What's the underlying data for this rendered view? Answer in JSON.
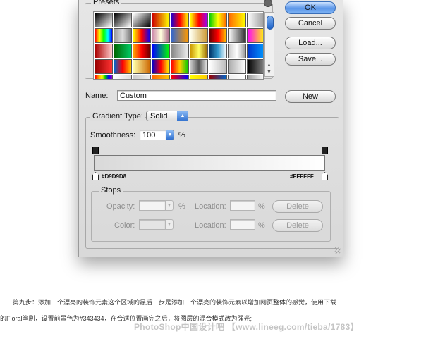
{
  "dialog": {
    "presets_label": "Presets",
    "buttons": {
      "ok": "OK",
      "cancel": "Cancel",
      "load": "Load...",
      "save": "Save...",
      "new": "New"
    },
    "name_label": "Name:",
    "name_value": "Custom",
    "gradient_type_label": "Gradient Type:",
    "gradient_type_value": "Solid",
    "smoothness_label": "Smoothness:",
    "smoothness_value": "100",
    "percent": "%",
    "left_stop_color": "#D9D9D8",
    "right_stop_color": "#FFFFFF",
    "stops": {
      "label": "Stops",
      "opacity_label": "Opacity:",
      "location_label": "Location:",
      "color_label": "Color:",
      "delete_label": "Delete"
    }
  },
  "presets_swatches": [
    "linear-gradient(135deg,#000,#fff)",
    "linear-gradient(135deg,#000,transparent)",
    "linear-gradient(135deg,#fff,#000)",
    "linear-gradient(90deg,#c00,#ff0)",
    "linear-gradient(90deg,#20c,#f00,#ff0)",
    "linear-gradient(90deg,#ff0,#f00,#90f)",
    "linear-gradient(90deg,#0c0,#ff0,#f60)",
    "linear-gradient(90deg,#f60,#ff0)",
    "linear-gradient(90deg,#fff,#999)",
    "linear-gradient(90deg,#f00,#ff0,#0f0,#0ff,#00f)",
    "linear-gradient(90deg,#999,#ddd,#777)",
    "linear-gradient(90deg,#ff0,#f00,#00f)",
    "linear-gradient(90deg,#c8a,#ffd,#a68)",
    "linear-gradient(90deg,#36c,#f90)",
    "linear-gradient(90deg,#ffe,#c93)",
    "linear-gradient(90deg,#600,#f00,#fc0)",
    "linear-gradient(90deg,#fff,#999,#333)",
    "linear-gradient(90deg,#f0f,#ff0)",
    "linear-gradient(90deg,#a00,#fcc)",
    "linear-gradient(90deg,#060,#0c6)",
    "linear-gradient(90deg,#fa0,#f00,#600)",
    "linear-gradient(90deg,#00f,#0f0)",
    "linear-gradient(90deg,#888,#eee)",
    "linear-gradient(90deg,#c90,#ff6,#960)",
    "linear-gradient(90deg,#036,#39c,#fff)",
    "linear-gradient(90deg,#ccc,#fff,#999)",
    "linear-gradient(90deg,#03c,#09f)",
    "linear-gradient(90deg,#900,#f33)",
    "linear-gradient(90deg,#06c,#f00,#fc0)",
    "linear-gradient(90deg,#ffa,#c60)",
    "linear-gradient(90deg,#00c,#f00,#ff0)",
    "linear-gradient(90deg,#f00,#fc0,#0c0)",
    "linear-gradient(90deg,#ccc,#555,#eee)",
    "linear-gradient(90deg,#fff,#bbb)",
    "linear-gradient(90deg,#aaa,#fff)",
    "linear-gradient(90deg,#000,#888)",
    "linear-gradient(90deg,#f00,#f90,#ff0,#0c0,#00f,#90c)",
    "linear-gradient(90deg,#fff,#ddd)",
    "linear-gradient(90deg,#ccc,#eee)",
    "linear-gradient(90deg,#f60,#fc0)",
    "linear-gradient(90deg,#f00,#00f)",
    "linear-gradient(90deg,#ff0,#fc0)",
    "linear-gradient(90deg,#900,#06c)",
    "linear-gradient(90deg,#eee,#fff)",
    "linear-gradient(90deg,#999,#fff)"
  ],
  "caption": {
    "line1": "第九步：添加一个漂亮的装饰元素这个区域的最后一步是添加一个漂亮的装饰元素以增加网页整体的感觉，使用下载",
    "line2": "的Floral笔刷，设置前景色为#343434，在合适位置画完之后，将图层的混合模式改为强光;"
  },
  "watermark": "PhotoShop中国设计吧 【www.lineeg.com/tieba/1783】"
}
